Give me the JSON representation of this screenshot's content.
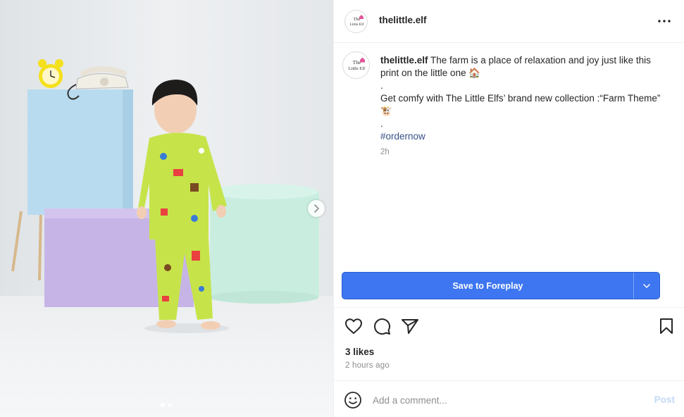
{
  "post": {
    "username": "thelittle.elf",
    "avatar_text_line1": "The",
    "avatar_text_line2": "Little Elf",
    "more_icon": "more-horizontal-icon"
  },
  "media": {
    "next_icon": "chevron-right-icon",
    "slide_count": 2,
    "active_slide": 1,
    "colors": {
      "background": "#e8ebee",
      "pajama": "#c6e44a",
      "blue_block": "#b9dbef",
      "purple_block": "#c6b4e6",
      "mint_cylinder": "#c9eee0",
      "clock": "#f4e01c"
    }
  },
  "caption": {
    "username": "thelittle.elf",
    "line1": "The farm is a place of relaxation and joy just like this print on the little one 🏠",
    "dot1": ".",
    "line2": "Get comfy with The Little Elfs’ brand new collection :“Farm Theme” 🐮",
    "dot2": ".",
    "hashtag": "#ordernow",
    "time": "2h"
  },
  "save": {
    "label": "Save to Foreplay",
    "dropdown_icon": "chevron-down-icon",
    "color": "#3d76f0"
  },
  "actions": {
    "like_icon": "heart-icon",
    "comment_icon": "comment-icon",
    "share_icon": "send-icon",
    "bookmark_icon": "bookmark-icon"
  },
  "stats": {
    "likes": "3 likes",
    "time_ago": "2 hours ago"
  },
  "comment": {
    "placeholder": "Add a comment...",
    "post_label": "Post",
    "emoji_icon": "smiley-icon"
  }
}
